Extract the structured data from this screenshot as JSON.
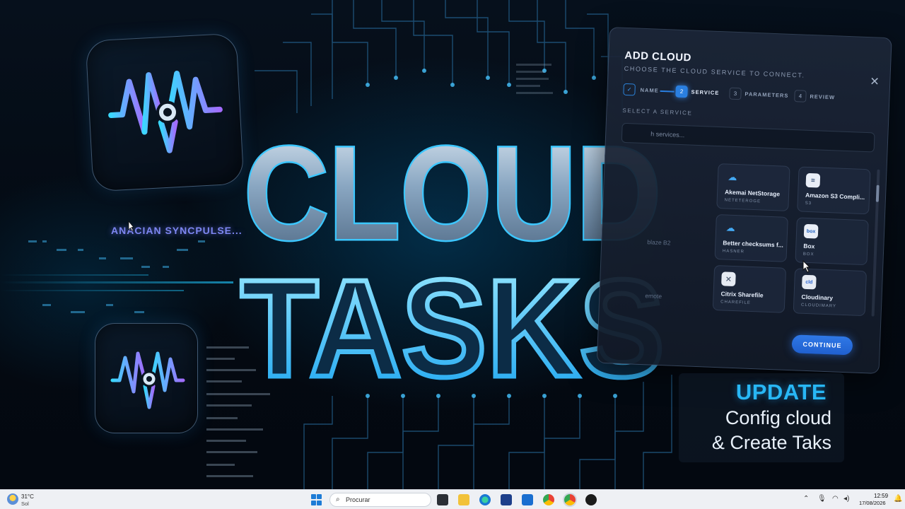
{
  "hero": {
    "title_line1": "CLOUD",
    "title_line2": "TASKS",
    "brand_text": "ANACIAN SYNCPULSE..."
  },
  "dialog": {
    "title": "ADD CLOUD",
    "subtitle": "CHOOSE THE CLOUD SERVICE TO CONNECT.",
    "close_icon": "close-icon",
    "steps": [
      {
        "num": "✓",
        "label": "NAME",
        "state": "done"
      },
      {
        "num": "2",
        "label": "SERVICE",
        "state": "active"
      },
      {
        "num": "3",
        "label": "PARAMETERS",
        "state": "todo"
      },
      {
        "num": "4",
        "label": "REVIEW",
        "state": "todo"
      }
    ],
    "section_label": "SELECT A SERVICE",
    "search_placeholder": "h services...",
    "services": [
      {
        "name": "Akemai NetStorage",
        "code": "NETETEROGE",
        "icon": "cloud-icon"
      },
      {
        "name": "Amazon S3 Compli...",
        "code": "S3",
        "icon": "document-icon"
      },
      {
        "name": "Better checksums f...",
        "code": "HASNER",
        "icon": "cloud-icon"
      },
      {
        "name": "Box",
        "code": "BOX",
        "icon": "box-icon",
        "icon_text": "box"
      },
      {
        "name": "Citrix Sharefile",
        "code": "CHAREFILE",
        "icon": "citrix-icon"
      },
      {
        "name": "Cloudinary",
        "code": "CLOUDIMARY",
        "icon": "cloudinary-icon",
        "icon_text": "cld"
      }
    ],
    "partial_items": [
      "blaze B2",
      "emote"
    ],
    "continue_label": "CONTINUE"
  },
  "update": {
    "title": "UPDATE",
    "line1": "Config cloud",
    "line2": "& Create Taks"
  },
  "taskbar": {
    "weather_temp": "31°C",
    "weather_cond": "Sol",
    "search_placeholder": "Procurar",
    "time": "12:59",
    "date": "17/08/2026"
  },
  "colors": {
    "accent_blue": "#2a7fe0",
    "title_cyan": "#28b7f5",
    "background": "#04070d"
  }
}
